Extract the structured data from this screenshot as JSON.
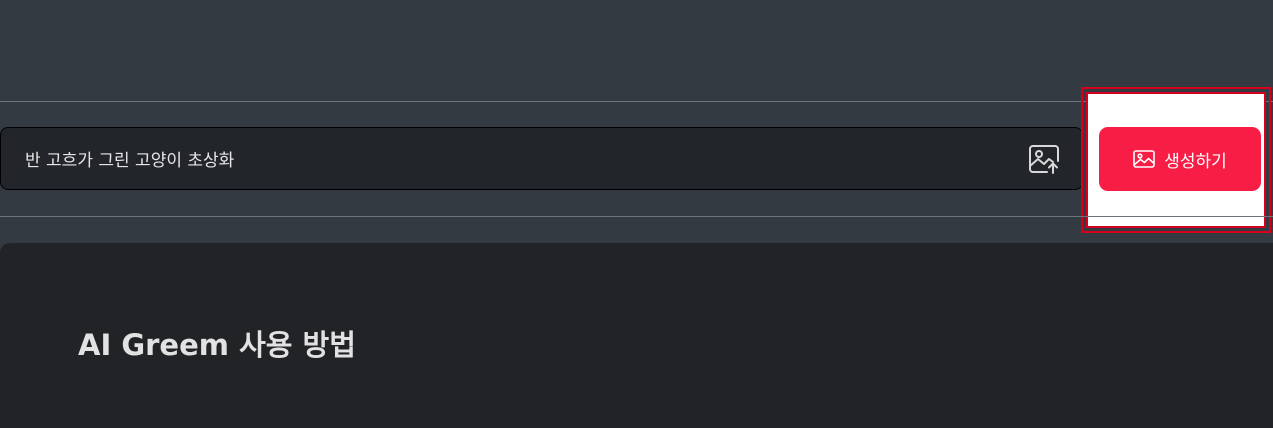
{
  "prompt": {
    "value": "반 고흐가 그린 고양이 초상화",
    "upload_icon": "image-upload-icon"
  },
  "generate": {
    "label": "생성하기",
    "icon": "image-icon",
    "color": "#f71d45"
  },
  "guide": {
    "title": "AI Greem 사용 방법"
  },
  "colors": {
    "background": "#343a42",
    "input_background": "#22252a",
    "panel_background": "#212327",
    "highlight": "#d6001c"
  }
}
